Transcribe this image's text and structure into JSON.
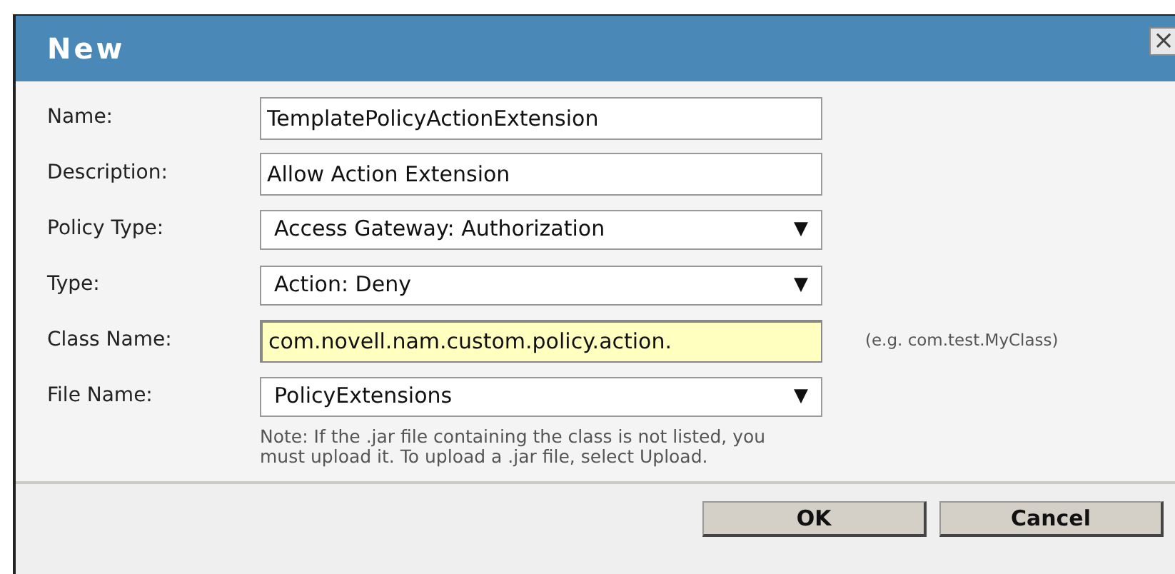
{
  "dialog": {
    "title": "New",
    "close": "×"
  },
  "fields": [
    {
      "label": "Name:",
      "kind": "text",
      "value": "TemplatePolicyActionExtension",
      "highlighted": false
    },
    {
      "label": "Description:",
      "kind": "text",
      "value": "Allow Action Extension",
      "highlighted": false
    },
    {
      "label": "Policy Type:",
      "kind": "select",
      "value": "Access Gateway: Authorization",
      "arrow": "▼"
    },
    {
      "label": "Type:",
      "kind": "select",
      "value": "Action: Deny",
      "arrow": "▼"
    },
    {
      "label": "Class Name:",
      "kind": "text",
      "value": "com.novell.nam.custom.policy.action.",
      "highlighted": true,
      "hint": "(e.g. com.test.MyClass)"
    },
    {
      "label": "File Name:",
      "kind": "select",
      "value": "PolicyExtensions",
      "arrow": "▼"
    }
  ],
  "note": [
    "Note: If the .jar file containing the class is not listed, you",
    "must upload it. To upload a .jar file, select Upload."
  ],
  "buttons": [
    "OK",
    "Cancel"
  ]
}
